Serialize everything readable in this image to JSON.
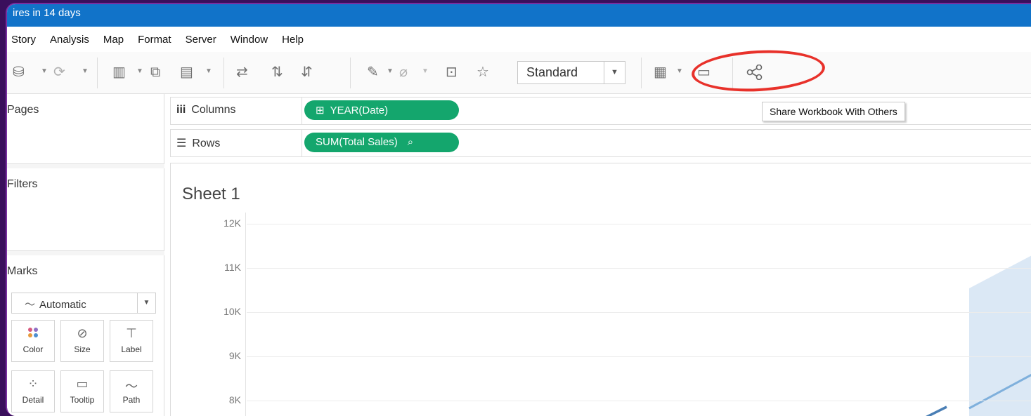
{
  "window": {
    "title": "ires in 14 days"
  },
  "menu": [
    "Story",
    "Analysis",
    "Map",
    "Format",
    "Server",
    "Window",
    "Help"
  ],
  "toolbar": {
    "fit_select": "Standard",
    "share_tooltip": "Share Workbook With Others"
  },
  "left_pane": {
    "pages_title": "Pages",
    "filters_title": "Filters",
    "marks_title": "Marks",
    "mark_type": "Automatic",
    "mark_buttons": [
      "Color",
      "Size",
      "Label",
      "Detail",
      "Tooltip",
      "Path"
    ]
  },
  "shelves": {
    "columns_label": "Columns",
    "columns_pill": "YEAR(Date)",
    "rows_label": "Rows",
    "rows_pill": "SUM(Total Sales)"
  },
  "sheet": {
    "title": "Sheet 1"
  },
  "chart_data": {
    "type": "line",
    "y_ticks": [
      "12K",
      "11K",
      "10K",
      "9K",
      "8K"
    ],
    "ylim": [
      7700,
      12000
    ],
    "band_color": "#cfe0f1",
    "line_color": "#4a7fb5"
  },
  "colors": {
    "pill": "#14a66d",
    "titlebar": "#1173c9",
    "highlight": "#e8312a"
  }
}
